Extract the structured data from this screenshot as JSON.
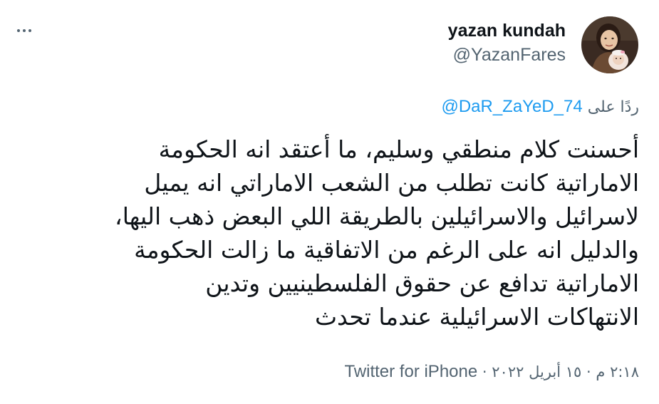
{
  "header": {
    "more_icon": "more-horizontal-icon",
    "display_name": "yazan kundah",
    "handle": "@YazanFares",
    "avatar_icon": "profile-avatar-icon"
  },
  "reply": {
    "prefix": "ردًا على",
    "mention": "@DaR_ZaYeD_74"
  },
  "tweet": {
    "lines": [
      "أحسنت كلام منطقي وسليم، ما أعتقد انه الحكومة",
      "الاماراتية كانت تطلب من الشعب الاماراتي انه يميل",
      "لاسرائيل والاسرائيلين بالطريقة اللي البعض ذهب اليها،",
      "والدليل انه على الرغم من الاتفاقية ما زالت الحكومة",
      "الاماراتية تدافع عن حقوق الفلسطينيين وتدين",
      "الانتهاكات الاسرائيلية عندما تحدث"
    ]
  },
  "meta": {
    "time": "٢:١٨ م",
    "separator": "·",
    "date": "١٥ أبريل ٢٠٢٢",
    "source": "Twitter for iPhone"
  },
  "colors": {
    "text": "#0f1419",
    "secondary": "#536471",
    "link": "#1d9bf0"
  }
}
